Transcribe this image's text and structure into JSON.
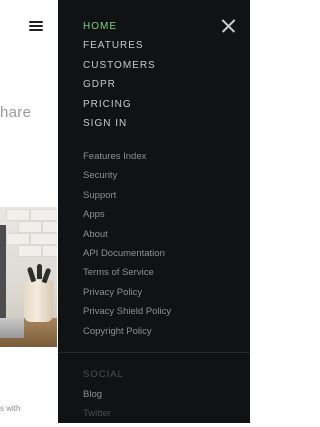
{
  "page": {
    "hero_fragment": "hare",
    "footer_fragment": "s with"
  },
  "menu": {
    "primary": [
      {
        "label": "HOME",
        "active": true
      },
      {
        "label": "FEATURES",
        "active": false
      },
      {
        "label": "CUSTOMERS",
        "active": false
      },
      {
        "label": "GDPR",
        "active": false
      },
      {
        "label": "PRICING",
        "active": false
      },
      {
        "label": "SIGN IN",
        "active": false
      }
    ],
    "secondary": [
      "Features Index",
      "Security",
      "Support",
      "Apps",
      "About",
      "API Documentation",
      "Terms of Service",
      "Privacy Policy",
      "Privacy Shield Policy",
      "Copyright Policy"
    ],
    "social": {
      "heading": "SOCIAL",
      "items": [
        "Blog",
        "Twitter"
      ]
    }
  },
  "colors": {
    "menu_background": "#111213",
    "active_item": "#7fd18a"
  },
  "icons": {
    "open_menu": "hamburger-icon",
    "close_menu": "close-icon"
  }
}
